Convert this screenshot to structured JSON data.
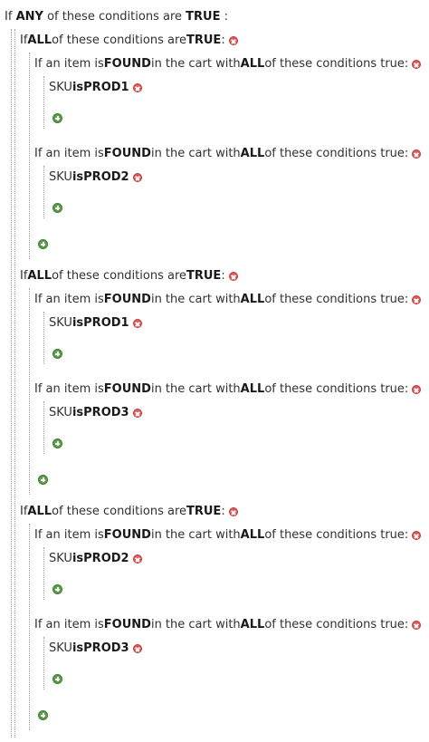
{
  "words": {
    "if": "If",
    "any": "ANY",
    "all": "ALL",
    "of_these_conditions_are": "of these conditions are",
    "true_word": "TRUE",
    "colon": ":",
    "if_an_item_is": "If an item is",
    "found": "FOUND",
    "in_the_cart_with": "in the cart with",
    "of_these_conditions_true": "of these conditions true:",
    "sku": "SKU",
    "is": "is"
  },
  "groups": [
    {
      "items": [
        {
          "sku": "PROD1"
        },
        {
          "sku": "PROD2"
        }
      ]
    },
    {
      "items": [
        {
          "sku": "PROD1"
        },
        {
          "sku": "PROD3"
        }
      ]
    },
    {
      "items": [
        {
          "sku": "PROD2"
        },
        {
          "sku": "PROD3"
        }
      ]
    }
  ],
  "icons": {
    "remove": "remove-condition-icon",
    "add": "add-condition-icon"
  },
  "colors": {
    "remove_icon": "#e05a5a",
    "add_icon": "#5f9e4f",
    "tree_line": "#9a9a9a"
  }
}
